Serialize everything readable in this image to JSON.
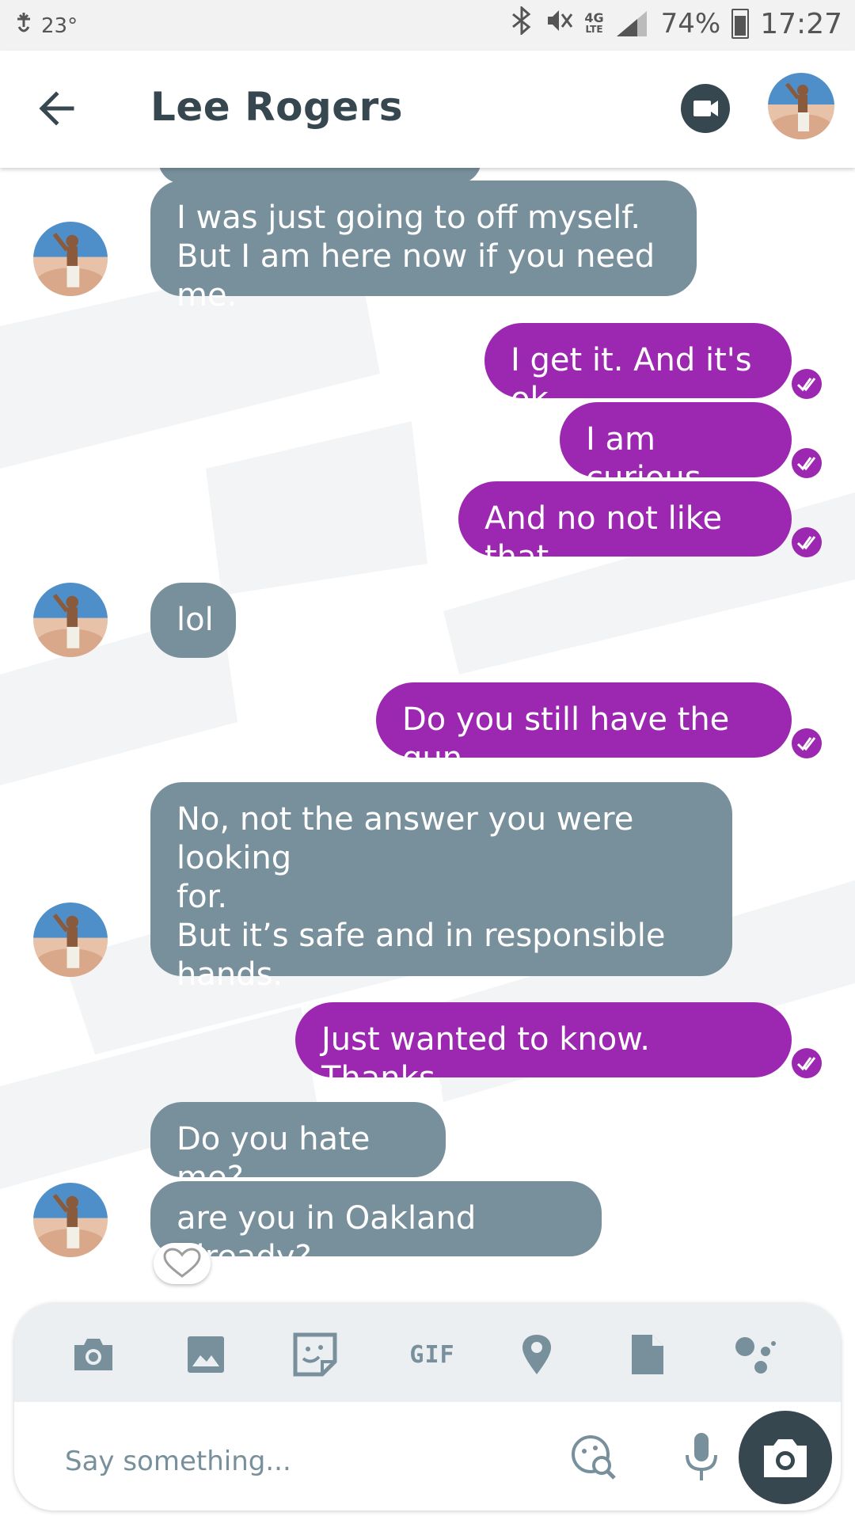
{
  "status_bar": {
    "temperature": "23°",
    "network": "4G",
    "network_sub": "LTE",
    "battery": "74%",
    "time": "17:27"
  },
  "header": {
    "contact_name": "Lee Rogers"
  },
  "messages": [
    {
      "dir": "in",
      "lines": [
        "I was just going to off myself.",
        "But I am here now if you need me."
      ]
    },
    {
      "dir": "out",
      "lines": [
        "I get it. And it's ok"
      ]
    },
    {
      "dir": "out",
      "lines": [
        "I am curious"
      ]
    },
    {
      "dir": "out",
      "lines": [
        "And no not like that"
      ]
    },
    {
      "dir": "in",
      "lines": [
        "lol"
      ]
    },
    {
      "dir": "out",
      "lines": [
        "Do you still have the gun"
      ]
    },
    {
      "dir": "in",
      "lines": [
        "No, not the answer you were looking",
        "for.",
        "But it’s safe and in responsible",
        "hands."
      ]
    },
    {
      "dir": "out",
      "lines": [
        "Just wanted to know. Thanks."
      ]
    },
    {
      "dir": "in",
      "lines": [
        "Do you hate me?"
      ]
    },
    {
      "dir": "in",
      "lines": [
        "are you in Oakland already?"
      ]
    }
  ],
  "compose": {
    "gif_label": "GIF",
    "placeholder": "Say something..."
  },
  "colors": {
    "incoming": "#78909c",
    "outgoing": "#9c27b0",
    "header_text": "#37474f"
  }
}
